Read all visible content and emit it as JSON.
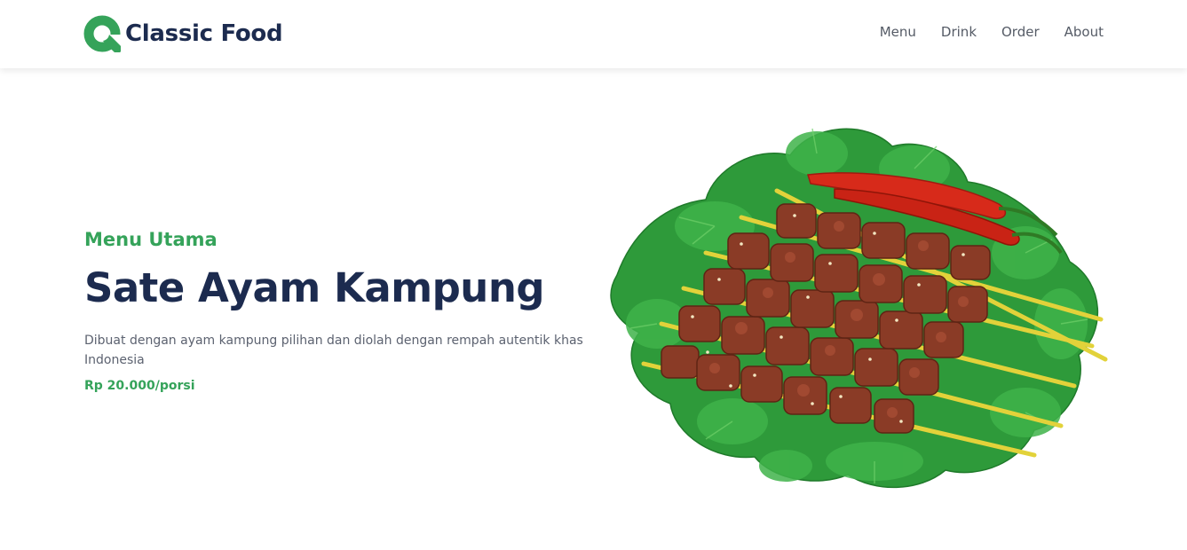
{
  "brand": {
    "name": "Classic Food",
    "logo_icon": "logo-q-icon",
    "accent": "#35a35a"
  },
  "nav": {
    "items": [
      {
        "label": "Menu"
      },
      {
        "label": "Drink"
      },
      {
        "label": "Order"
      },
      {
        "label": "About"
      }
    ]
  },
  "hero": {
    "eyebrow": "Menu Utama",
    "title": "Sate Ayam Kampung",
    "description": "Dibuat dengan ayam kampung pilihan dan diolah dengan rempah autentik khas Indonesia",
    "price": "Rp 20.000/porsi",
    "image": "sate-ayam-image"
  },
  "colors": {
    "accent_green": "#35a35a",
    "heading_navy": "#1c2b4f",
    "body_gray": "#5c6270"
  }
}
